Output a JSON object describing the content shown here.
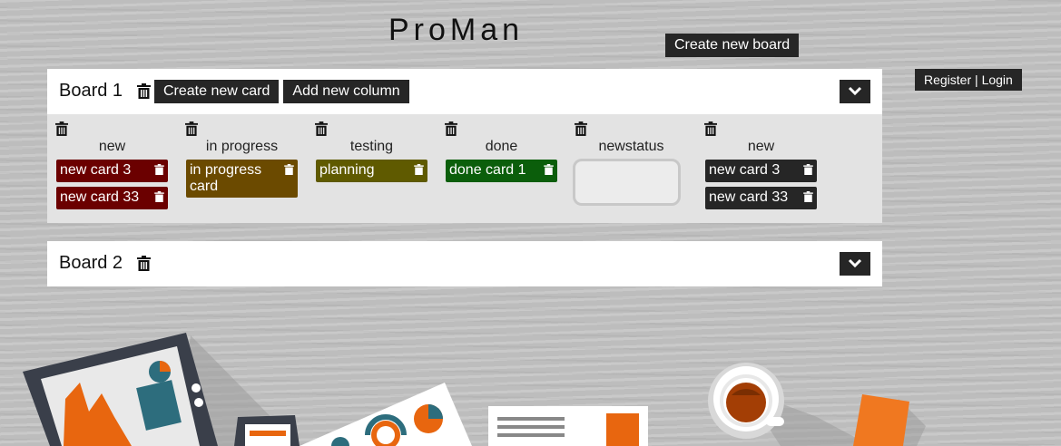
{
  "app": {
    "title": "ProMan"
  },
  "header": {
    "create_board_label": "Create new board"
  },
  "auth": {
    "register_label": "Register",
    "separator": " | ",
    "login_label": "Login"
  },
  "board1": {
    "title": "Board 1",
    "create_card_label": "Create new card",
    "add_column_label": "Add new column",
    "columns": [
      {
        "title": "new",
        "cards": [
          {
            "text": "new card 3",
            "color": "#6b0000"
          },
          {
            "text": "new card 33",
            "color": "#6b0000"
          }
        ]
      },
      {
        "title": "in progress",
        "cards": [
          {
            "text": "in progress card",
            "color": "#6b4a00"
          }
        ]
      },
      {
        "title": "testing",
        "cards": [
          {
            "text": "planning",
            "color": "#5f5a00"
          }
        ]
      },
      {
        "title": "done",
        "cards": [
          {
            "text": "done card 1",
            "color": "#0b5e0b"
          }
        ]
      },
      {
        "title": "newstatus",
        "cards": []
      },
      {
        "title": "new",
        "cards": [
          {
            "text": "new card 3",
            "color": "#262626"
          },
          {
            "text": "new card 33",
            "color": "#262626"
          }
        ]
      }
    ]
  },
  "board2": {
    "title": "Board 2"
  },
  "icons": {
    "trash": "trash-icon",
    "toggle": "chevron-down-icon"
  }
}
